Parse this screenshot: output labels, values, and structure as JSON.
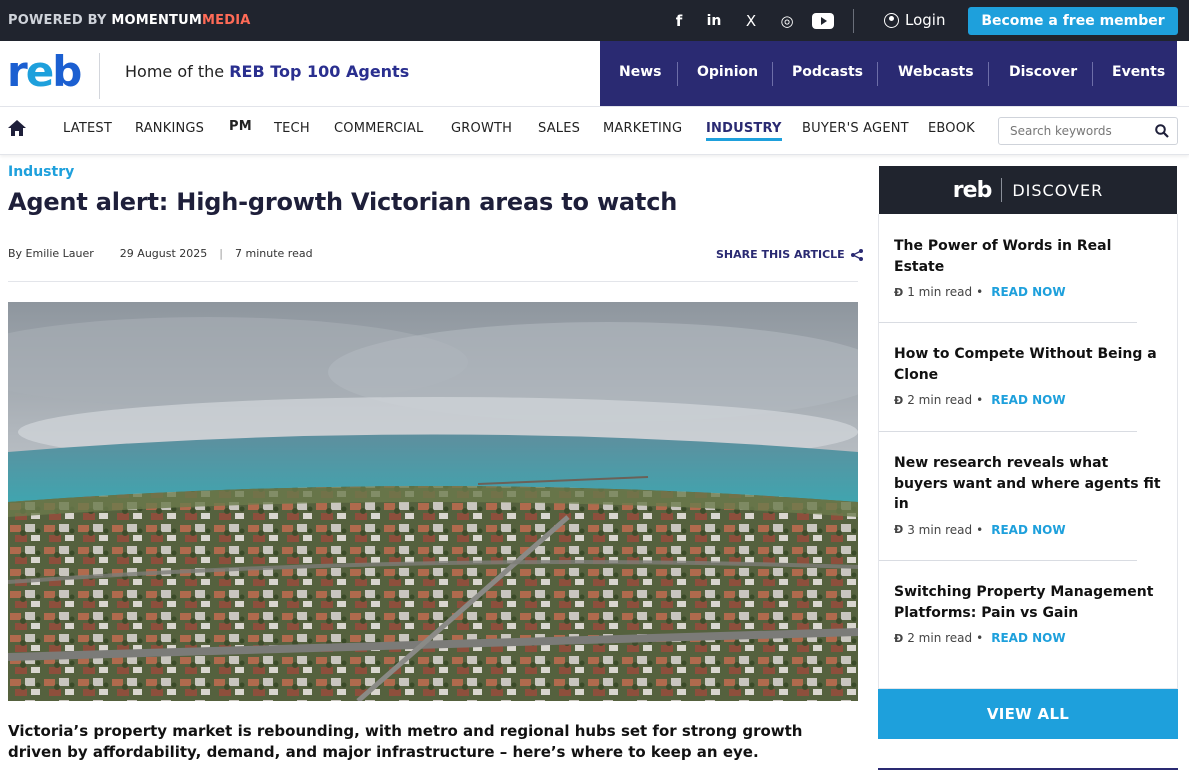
{
  "topbar": {
    "powered_prefix": "POWERED BY",
    "powered_brand_a": "MOMENTUM",
    "powered_brand_b": "MEDIA",
    "social": [
      {
        "icon": "facebook-icon",
        "glyph": "f"
      },
      {
        "icon": "linkedin-icon",
        "glyph": "in"
      },
      {
        "icon": "x-twitter-icon",
        "glyph": "X"
      },
      {
        "icon": "instagram-icon",
        "glyph": "◎"
      },
      {
        "icon": "youtube-icon",
        "glyph": "▶"
      }
    ],
    "login_label": "Login",
    "member_button": "Become a free member"
  },
  "brand": {
    "logo_a": "r",
    "logo_b": "e",
    "logo_c": "b",
    "tagline_prefix": "Home of the ",
    "tagline_highlight": "REB Top 100 Agents"
  },
  "main_nav": [
    "News",
    "Opinion",
    "Podcasts",
    "Webcasts",
    "Discover",
    "Events"
  ],
  "categories": [
    "LATEST",
    "RANKINGS",
    "PM",
    "TECH",
    "COMMERCIAL",
    "GROWTH",
    "SALES",
    "MARKETING",
    "INDUSTRY",
    "BUYER'S AGENT",
    "EBOOK"
  ],
  "active_category": "INDUSTRY",
  "search": {
    "placeholder": "Search keywords"
  },
  "article": {
    "section": "Industry",
    "headline": "Agent alert: High-growth Victorian areas to watch",
    "byline": "By Emilie Lauer",
    "date": "29 August 2025",
    "separator": "|",
    "read_time": "7 minute read",
    "share_label": "SHARE THIS ARTICLE",
    "lede": "Victoria’s property market is rebounding, with metro and regional hubs set for strong growth driven by affordability, demand, and major infrastructure – here’s where to keep an eye."
  },
  "sidebar": {
    "header_brand": "reb",
    "header_section": "DISCOVER",
    "items": [
      {
        "title": "The Power of Words in Real Estate",
        "read": "1 min read",
        "dot": "•",
        "cta": "READ NOW"
      },
      {
        "title": "How to Compete Without Being a Clone",
        "read": "2 min read",
        "dot": "•",
        "cta": "READ NOW"
      },
      {
        "title": "New research reveals what buyers want and where agents fit in",
        "read": "3 min read",
        "dot": "•",
        "cta": "READ NOW"
      },
      {
        "title": "Switching Property Management Platforms: Pain vs Gain",
        "read": "2 min read",
        "dot": "•",
        "cta": "READ NOW"
      }
    ],
    "view_all": "VIEW ALL"
  },
  "colors": {
    "accent": "#1ea0dc",
    "navy": "#2a2a72",
    "topbar": "#20242e"
  }
}
